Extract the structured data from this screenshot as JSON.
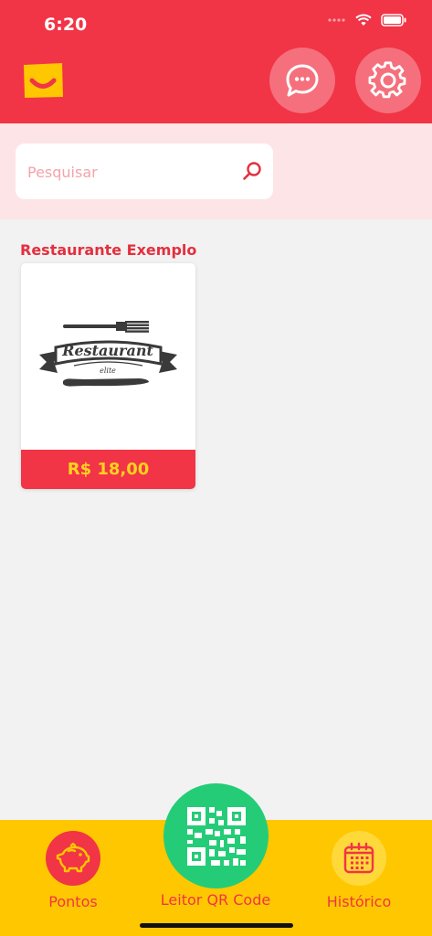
{
  "status_bar": {
    "time": "6:20"
  },
  "search": {
    "placeholder": "Pesquisar",
    "value": ""
  },
  "section": {
    "title": "Restaurante Exemplo"
  },
  "card": {
    "banner_text": "Restaurant",
    "banner_sub": "elite",
    "price": "R$ 18,00"
  },
  "nav": {
    "pontos": "Pontos",
    "qr": "Leitor QR Code",
    "historico": "Histórico"
  },
  "colors": {
    "primary": "#f13446",
    "accent_yellow": "#ffc700",
    "qr_green": "#25cc77",
    "price_text": "#ffd21f"
  },
  "icons": [
    "chat-bubble-icon",
    "gear-icon",
    "search-icon",
    "piggy-bank-icon",
    "qr-code-icon",
    "calendar-icon",
    "wifi-icon",
    "battery-icon",
    "signal-icon"
  ]
}
